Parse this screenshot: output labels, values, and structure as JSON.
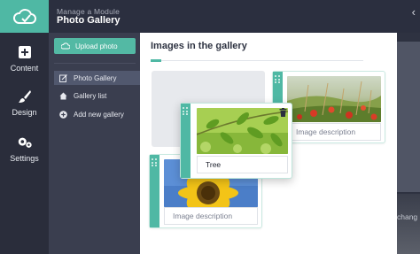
{
  "header": {
    "subtitle": "Manage a Module",
    "title": "Photo Gallery",
    "collapse_icon": "chevron-left-icon"
  },
  "rail": {
    "logo_icon": "cloud-check-icon",
    "items": [
      {
        "label": "Content",
        "icon": "plus-square-icon"
      },
      {
        "label": "Design",
        "icon": "brush-icon"
      },
      {
        "label": "Settings",
        "icon": "gears-icon"
      }
    ]
  },
  "subnav": {
    "upload_label": "Upload photo",
    "items": [
      {
        "label": "Photo Gallery",
        "icon": "edit-icon",
        "active": true
      },
      {
        "label": "Gallery list",
        "icon": "home-icon",
        "active": false
      },
      {
        "label": "Add new gallery",
        "icon": "plus-circle-icon",
        "active": false
      }
    ]
  },
  "main": {
    "title": "Images in the gallery"
  },
  "cards": [
    {
      "description": "Image description",
      "photo": "poppy field"
    },
    {
      "description": "Tree",
      "photo": "green leaves",
      "dragging": true
    },
    {
      "description": "Image description",
      "photo": "sunflower"
    }
  ],
  "background": {
    "partial_text": "chang"
  },
  "colors": {
    "accent": "#4fb8a4",
    "rail_bg": "#2a2d3b",
    "subnav_bg": "#3a3e4f",
    "active_item_bg": "#51586e"
  }
}
